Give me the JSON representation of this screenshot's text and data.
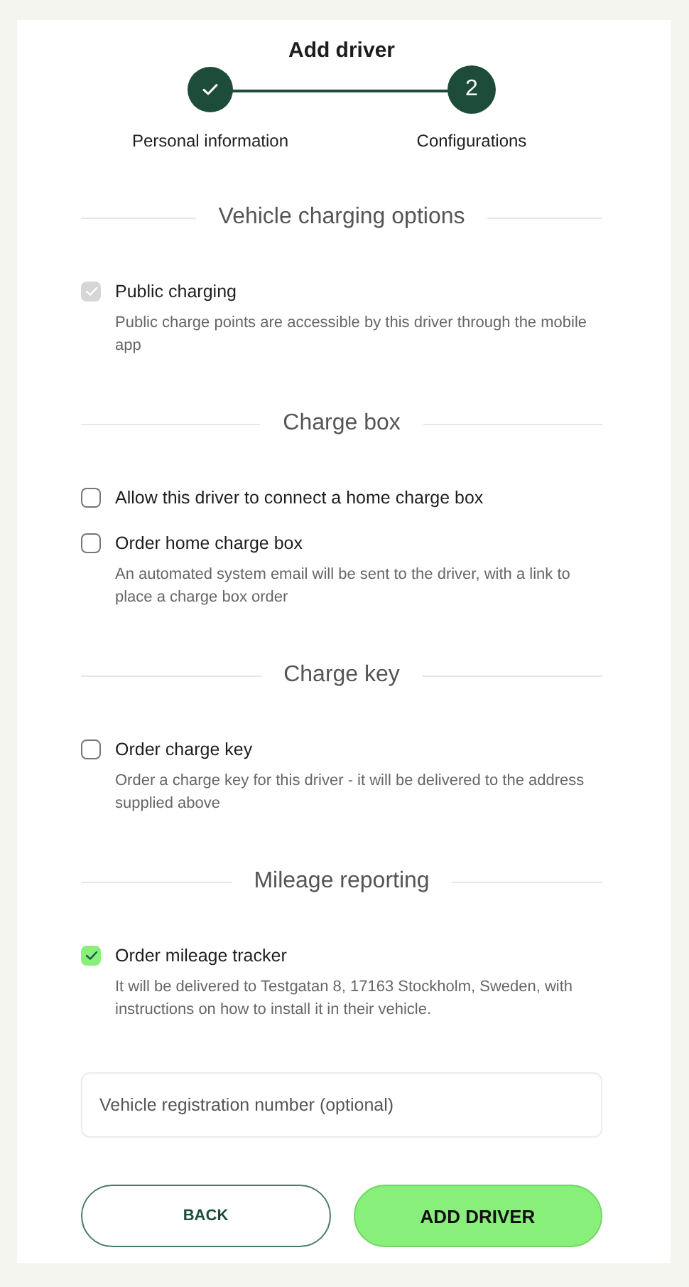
{
  "title": "Add driver",
  "steps": [
    {
      "label": "Personal information",
      "completed": true,
      "selected": false
    },
    {
      "label": "Configurations",
      "number": "2",
      "completed": false,
      "selected": true
    }
  ],
  "sections": [
    {
      "title": "Vehicle charging options",
      "options": [
        {
          "label": "Public charging",
          "description": "Public charge points are accessible by this driver through the mobile app",
          "checked": true,
          "disabled": true
        }
      ]
    },
    {
      "title": "Charge box",
      "options": [
        {
          "label": "Allow this driver to connect a home charge box",
          "checked": false,
          "disabled": false
        },
        {
          "label": "Order home charge box",
          "description": "An automated system email will be sent to the driver, with a link to place a charge box order",
          "checked": false,
          "disabled": false
        }
      ]
    },
    {
      "title": "Charge key",
      "options": [
        {
          "label": "Order charge key",
          "description": "Order a charge key for this driver - it will be delivered to the address supplied above",
          "checked": false,
          "disabled": false
        }
      ]
    },
    {
      "title": "Mileage reporting",
      "options": [
        {
          "label": "Order mileage tracker",
          "description": "It will be delivered to Testgatan 8, 17163 Stockholm, Sweden, with instructions on how to install it in their vehicle.",
          "checked": true,
          "disabled": false
        }
      ]
    }
  ],
  "registration_field": {
    "placeholder": "Vehicle registration number (optional)"
  },
  "buttons": [
    {
      "label": "BACK",
      "kind": "secondary"
    },
    {
      "label": "ADD DRIVER",
      "kind": "primary"
    }
  ]
}
